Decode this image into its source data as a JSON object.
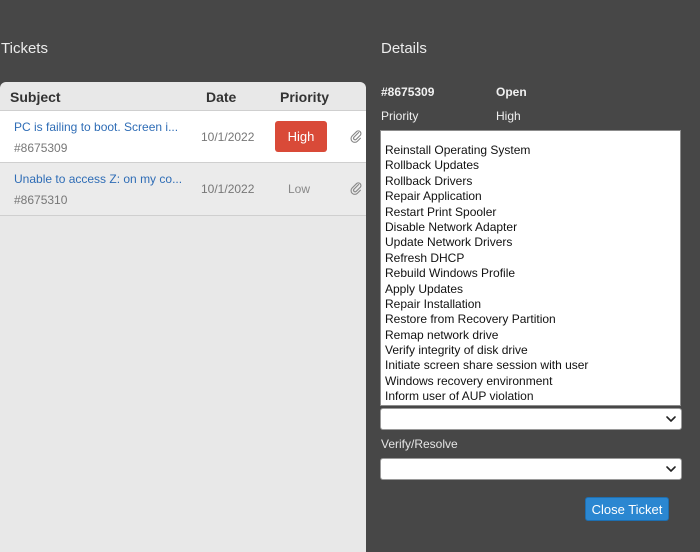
{
  "tickets_panel": {
    "title": "Tickets",
    "columns": {
      "subject": "Subject",
      "date": "Date",
      "priority": "Priority"
    },
    "rows": [
      {
        "subject": "PC is failing to boot. Screen i...",
        "id": "#8675309",
        "date": "10/1/2022",
        "priority": "High"
      },
      {
        "subject": "Unable to access Z: on my co...",
        "id": "#8675310",
        "date": "10/1/2022",
        "priority": "Low"
      }
    ]
  },
  "details_panel": {
    "title": "Details",
    "ticket_id": "#8675309",
    "status": "Open",
    "priority_label": "Priority",
    "priority_value": "High",
    "actions": [
      "Reinstall Operating System",
      "Rollback Updates",
      "Rollback Drivers",
      "Repair Application",
      "Restart Print Spooler",
      "Disable Network Adapter",
      "Update Network Drivers",
      "Refresh DHCP",
      "Rebuild Windows Profile",
      "Apply Updates",
      "Repair Installation",
      "Restore from Recovery Partition",
      "Remap network drive",
      "Verify integrity of disk drive",
      "Initiate screen share session with user",
      "Windows recovery environment",
      "Inform user of AUP violation"
    ],
    "verify_label": "Verify/Resolve",
    "close_button": "Close Ticket"
  },
  "colors": {
    "background": "#474747",
    "panel": "#e8e8e8",
    "link": "#2f6db6",
    "high_badge": "#d94a38",
    "button": "#2b87d1"
  },
  "icons": {
    "attachment": "paperclip-icon",
    "dropdown": "chevron-down-icon"
  }
}
